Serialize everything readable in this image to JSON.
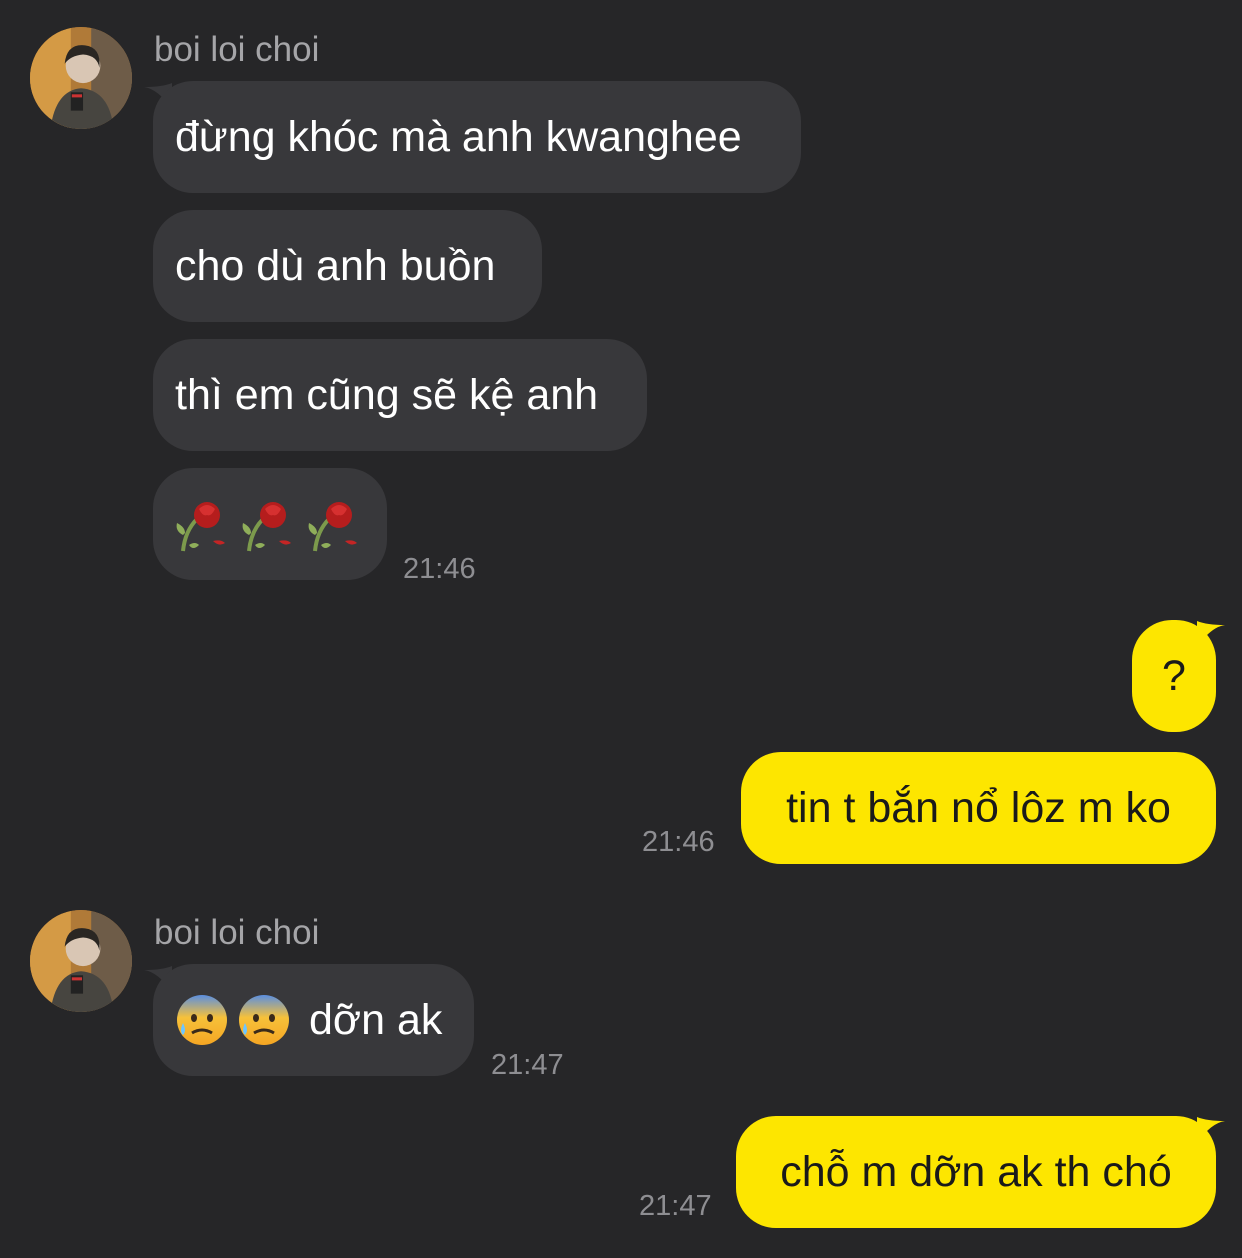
{
  "conversation": {
    "group1": {
      "sender_name": "boi loi choi",
      "messages": [
        "đừng khóc mà anh kwanghee",
        "cho dù anh buồn",
        "thì em cũng sẽ kệ anh"
      ],
      "emoji_message": {
        "icons": [
          "wilted-rose-icon",
          "wilted-rose-icon",
          "wilted-rose-icon"
        ]
      },
      "time": "21:46"
    },
    "outgoing1": {
      "messages": [
        "?",
        "tin t bắn nổ lôz m ko"
      ],
      "time": "21:46"
    },
    "group2": {
      "sender_name": "boi loi choi",
      "message_icons": [
        "anxious-face-sweat-icon",
        "anxious-face-sweat-icon"
      ],
      "message_text": "dỡn ak",
      "time": "21:47"
    },
    "outgoing2": {
      "messages": [
        "chỗ m dỡn ak th chó"
      ],
      "time": "21:47"
    }
  },
  "colors": {
    "background": "#262628",
    "incoming_bubble": "#38383b",
    "outgoing_bubble": "#fde600",
    "timestamp": "#8e8e92",
    "sender_name": "#a5a5a8"
  }
}
